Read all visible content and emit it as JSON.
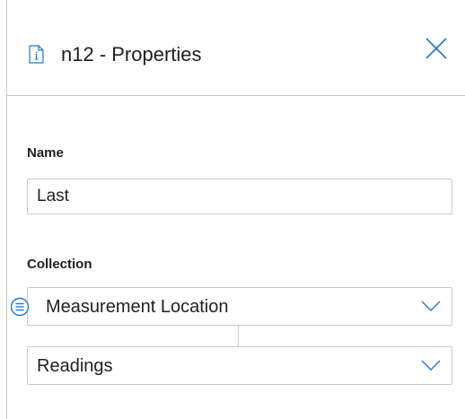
{
  "header": {
    "title": "n12 - Properties",
    "icon": "document-info-icon",
    "close_icon": "close-icon"
  },
  "fields": {
    "name_label": "Name",
    "name_value": "Last",
    "collection_label": "Collection"
  },
  "collection": {
    "primary_select": "Measurement Location",
    "secondary_select": "Readings",
    "list_icon": "list-icon",
    "dropdown_icon": "chevron-down-icon"
  },
  "colors": {
    "accent": "#1a7bd0",
    "border": "#c9c9c9",
    "text": "#1f1f1f"
  }
}
